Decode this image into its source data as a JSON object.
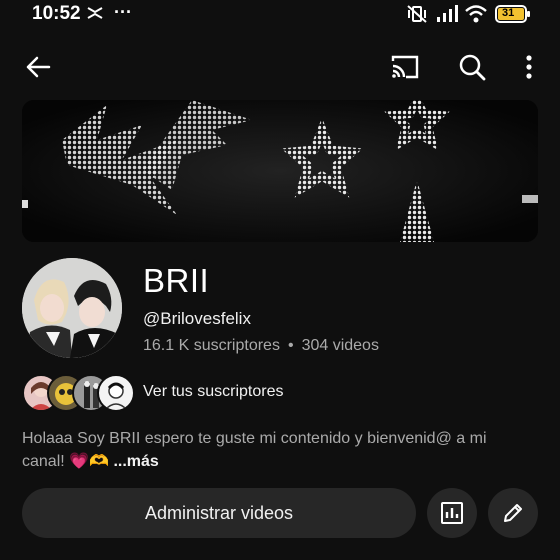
{
  "status": {
    "time": "10:52",
    "battery": "31"
  },
  "topbar": {
    "back_icon": "arrow-left-icon",
    "cast_icon": "cast-icon",
    "search_icon": "search-icon",
    "menu_icon": "more-vert-icon"
  },
  "channel": {
    "name": "BRII",
    "handle": "@Brilovesfelix",
    "subscribers": "16.1 K suscriptores",
    "videos": "304 videos"
  },
  "subs_row": {
    "label": "Ver tus suscriptores"
  },
  "description": {
    "text": "Holaaa Soy BRII espero te guste mi contenido y bienvenid@ a mi canal! 💗🫶",
    "more": "...más"
  },
  "actions": {
    "manage_label": "Administrar videos",
    "analytics_icon": "analytics-icon",
    "edit_icon": "pencil-icon"
  },
  "colors": {
    "background": "#0f0f0f",
    "button_bg": "#272727",
    "secondary_text": "#aaaaaa",
    "battery_fill": "#f2c230"
  }
}
